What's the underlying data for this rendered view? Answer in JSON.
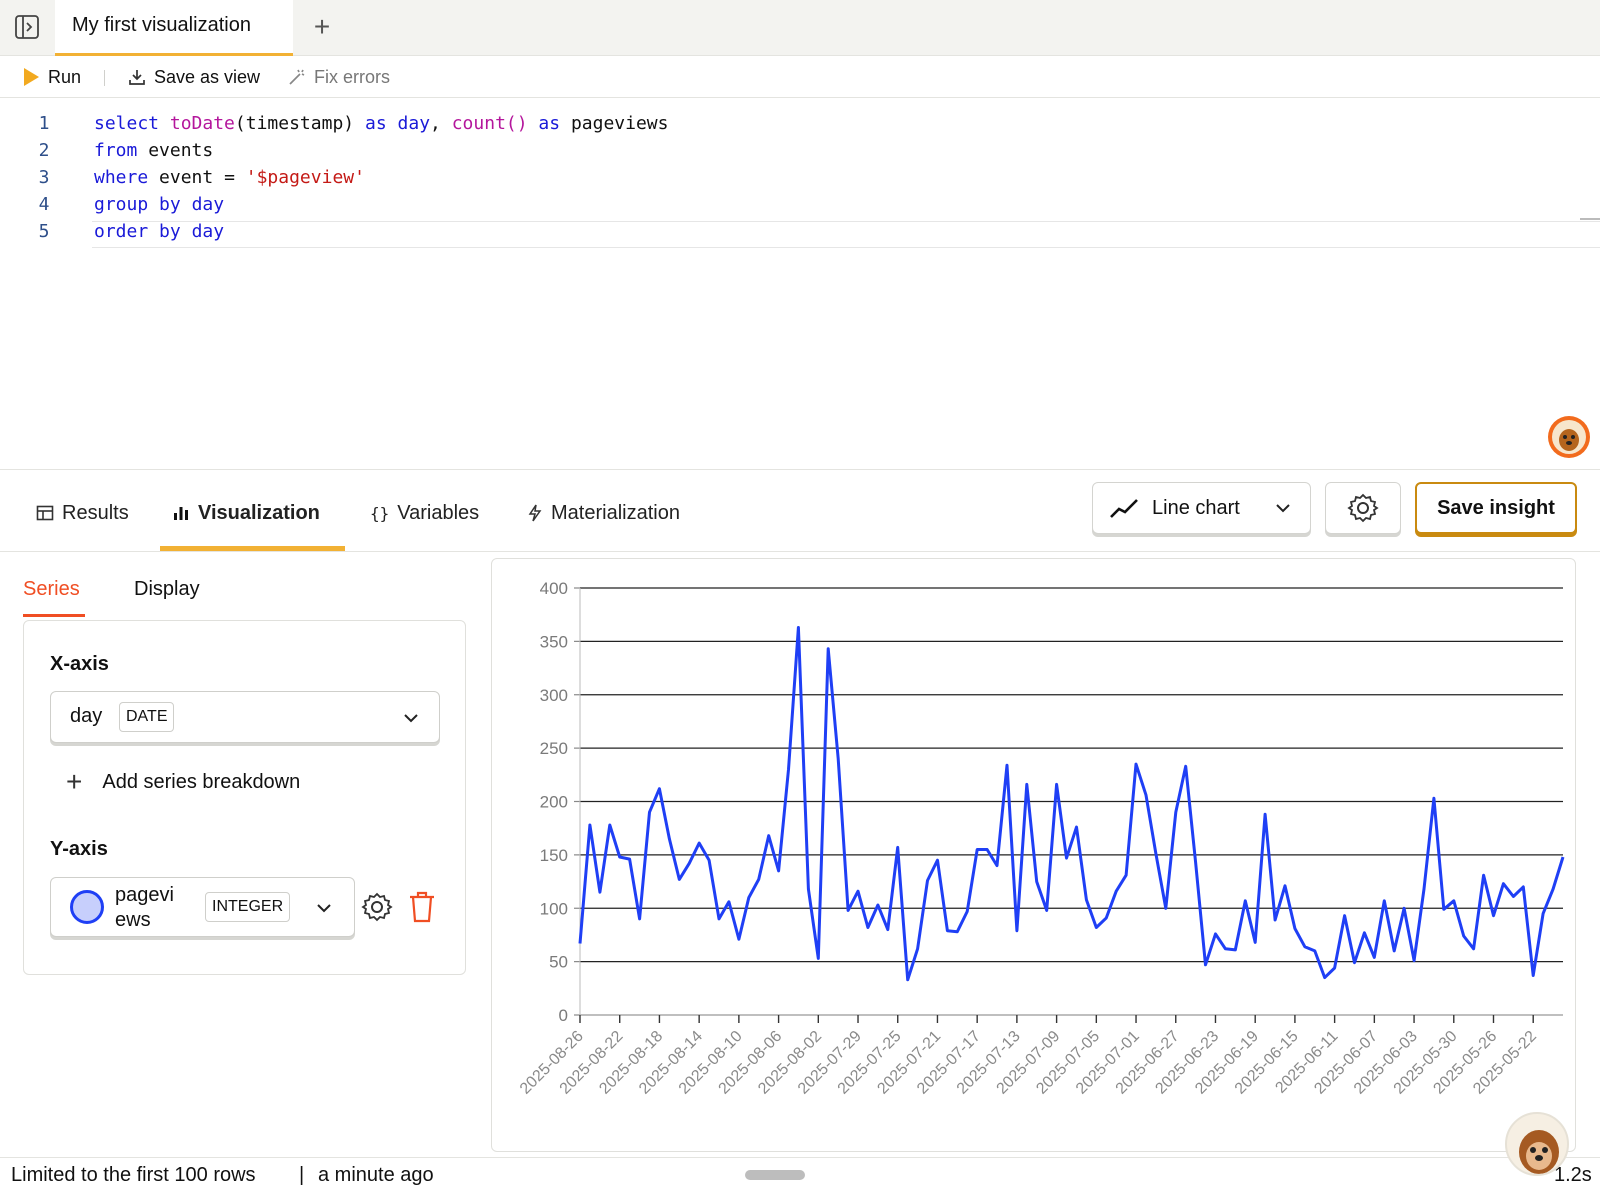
{
  "tabbar": {
    "active_tab": "My first visualization",
    "new_tab": "+"
  },
  "toolbar": {
    "run": "Run",
    "save_view": "Save as view",
    "fix_errors": "Fix errors"
  },
  "editor": {
    "lines": [
      {
        "num": "1"
      },
      {
        "num": "2"
      },
      {
        "num": "3"
      },
      {
        "num": "4"
      },
      {
        "num": "5"
      }
    ],
    "tokens": {
      "select": "select",
      "toDate": "toDate",
      "lp": "(",
      "timestamp": "timestamp",
      "rp": ")",
      "as1": "as",
      "day": "day",
      "comma": ",",
      "count": "count()",
      "as2": "as",
      "pageviews": "pageviews",
      "from": "from",
      "events": "events",
      "where": "where",
      "event": "event",
      "eq": "=",
      "pv": "'$pageview'",
      "group": "group",
      "by1": "by",
      "day2": "day",
      "order": "order",
      "by2": "by",
      "day3": "day"
    }
  },
  "panel_tabs": {
    "results": "Results",
    "visualization": "Visualization",
    "variables": "Variables",
    "materialization": "Materialization"
  },
  "actions": {
    "chart_type": "Line chart",
    "save_insight": "Save insight"
  },
  "subtabs": {
    "series": "Series",
    "display": "Display"
  },
  "series": {
    "x_axis_label": "X-axis",
    "x_field": "day",
    "x_type": "DATE",
    "add_breakdown": "Add series breakdown",
    "y_axis_label": "Y-axis",
    "y_field_line1": "pagevi",
    "y_field_line2": "ews",
    "y_type": "INTEGER"
  },
  "status": {
    "limit": "Limited to the first 100 rows",
    "sep": "|",
    "time": "a minute ago",
    "duration": "1.2s"
  },
  "colors": {
    "accent": "#f2b134",
    "series_line": "#1f3ff5",
    "series_tab": "#f04e23",
    "delete": "#f04e23"
  },
  "chart_data": {
    "type": "line",
    "ylim": [
      0,
      400
    ],
    "yticks": [
      0,
      50,
      100,
      150,
      200,
      250,
      300,
      350,
      400
    ],
    "xtick_labels": [
      "2025-08-26",
      "2025-08-22",
      "2025-08-18",
      "2025-08-14",
      "2025-08-10",
      "2025-08-06",
      "2025-08-02",
      "2025-07-29",
      "2025-07-25",
      "2025-07-21",
      "2025-07-17",
      "2025-07-13",
      "2025-07-09",
      "2025-07-05",
      "2025-07-01",
      "2025-06-27",
      "2025-06-23",
      "2025-06-19",
      "2025-06-15",
      "2025-06-11",
      "2025-06-07",
      "2025-06-03",
      "2025-05-30",
      "2025-05-26",
      "2025-05-22"
    ],
    "series": [
      {
        "values": [
          67,
          178,
          115,
          178,
          148,
          146,
          90,
          190,
          212,
          165,
          127,
          142,
          161,
          145,
          90,
          106,
          71,
          110,
          127,
          168,
          135,
          230,
          363,
          118,
          53,
          343,
          240,
          98,
          116,
          82,
          103,
          80,
          157,
          33,
          62,
          126,
          145,
          79,
          78,
          97,
          155,
          155,
          140,
          234,
          79,
          216,
          125,
          98,
          216,
          147,
          176,
          108,
          82,
          91,
          116,
          131,
          235,
          206,
          151,
          100,
          190,
          233,
          143,
          47,
          76,
          62,
          61,
          107,
          68,
          188,
          89,
          121,
          81,
          64,
          60,
          35,
          44,
          93,
          49,
          77,
          54,
          107,
          60,
          100,
          51,
          118,
          203,
          99,
          107,
          74,
          62,
          131,
          93,
          123,
          111,
          120,
          37,
          95,
          118,
          148
        ]
      }
    ]
  }
}
